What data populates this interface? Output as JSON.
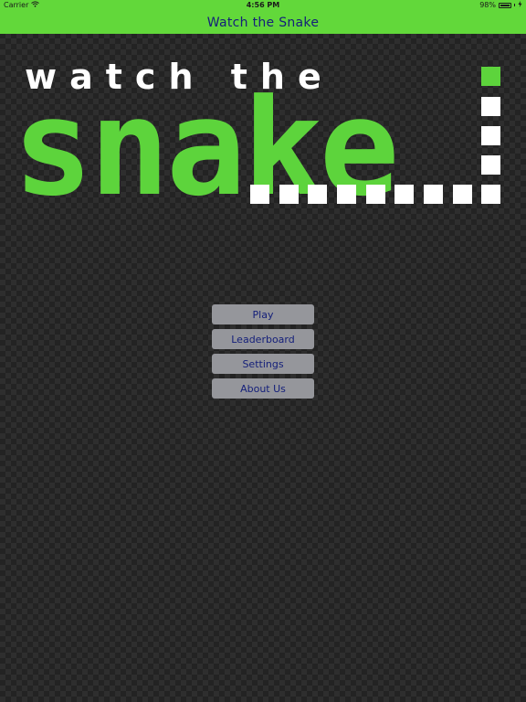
{
  "status_bar": {
    "carrier": "Carrier",
    "time": "4:56 PM",
    "battery_percent": "98%",
    "battery_level": 0.98,
    "icons": [
      "wifi-icon",
      "battery-icon",
      "charging-icon"
    ]
  },
  "nav_bar": {
    "title": "Watch the Snake"
  },
  "logo": {
    "line1": "watch the",
    "line2": "snake"
  },
  "menu": {
    "play": "Play",
    "leaderboard": "Leaderboard",
    "settings": "Settings",
    "about_us": "About Us"
  },
  "colors": {
    "accent_green": "#62d83a",
    "logo_green": "#5dd43c",
    "button_gray": "#95969b",
    "button_text": "#15207a",
    "background": "#232323"
  }
}
